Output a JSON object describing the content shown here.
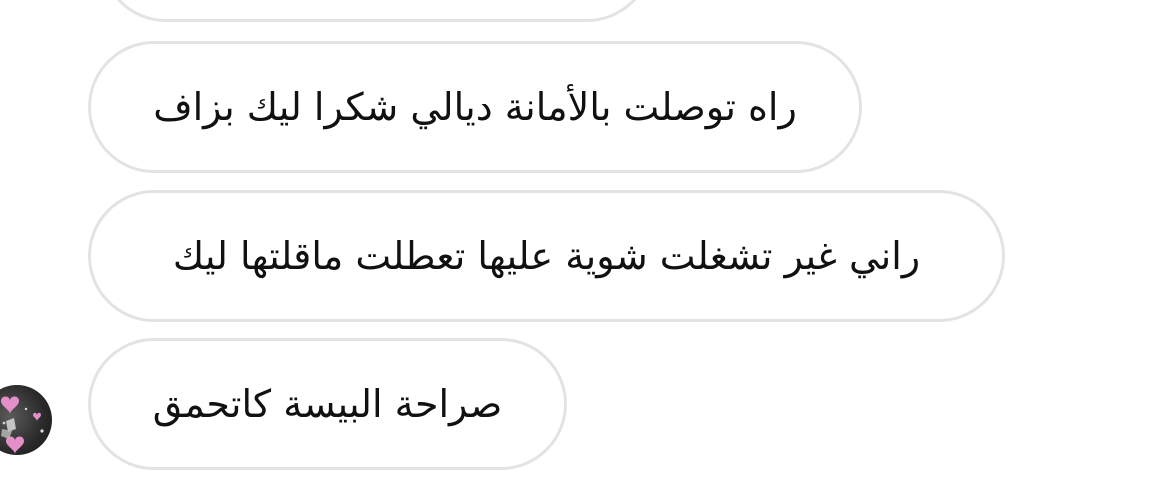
{
  "conversation": {
    "messages": [
      {
        "text": ""
      },
      {
        "text": "راه توصلت بالأمانة ديالي شكرا ليك بزاف"
      },
      {
        "text": "راني غير تشغلت شوية عليها تعطلت ماقلتها ليك"
      },
      {
        "text": "صراحة البيسة كاتحمق"
      }
    ]
  },
  "sender": {
    "avatar_icon": "profile-avatar-with-hearts"
  },
  "colors": {
    "bubble_border": "#e3e3e3",
    "bubble_background": "#ffffff",
    "text": "#111111",
    "heart": "#e58fc9"
  }
}
